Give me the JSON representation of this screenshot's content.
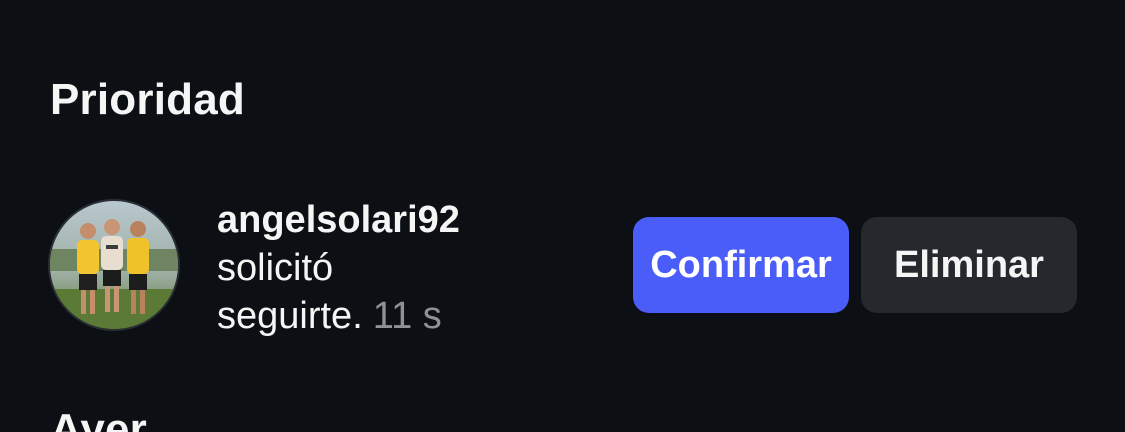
{
  "sections": {
    "priority_title": "Prioridad",
    "next_title": "Ayer"
  },
  "request": {
    "username": "angelsolari92",
    "message": "solicitó seguirte.",
    "time": "11 s",
    "avatar_icon": "profile-photo-avatar"
  },
  "actions": {
    "confirm_label": "Confirmar",
    "delete_label": "Eliminar"
  },
  "colors": {
    "background": "#0c1014",
    "confirm": "#4a5df9",
    "delete": "#25292e",
    "muted_text": "#8e9196"
  }
}
